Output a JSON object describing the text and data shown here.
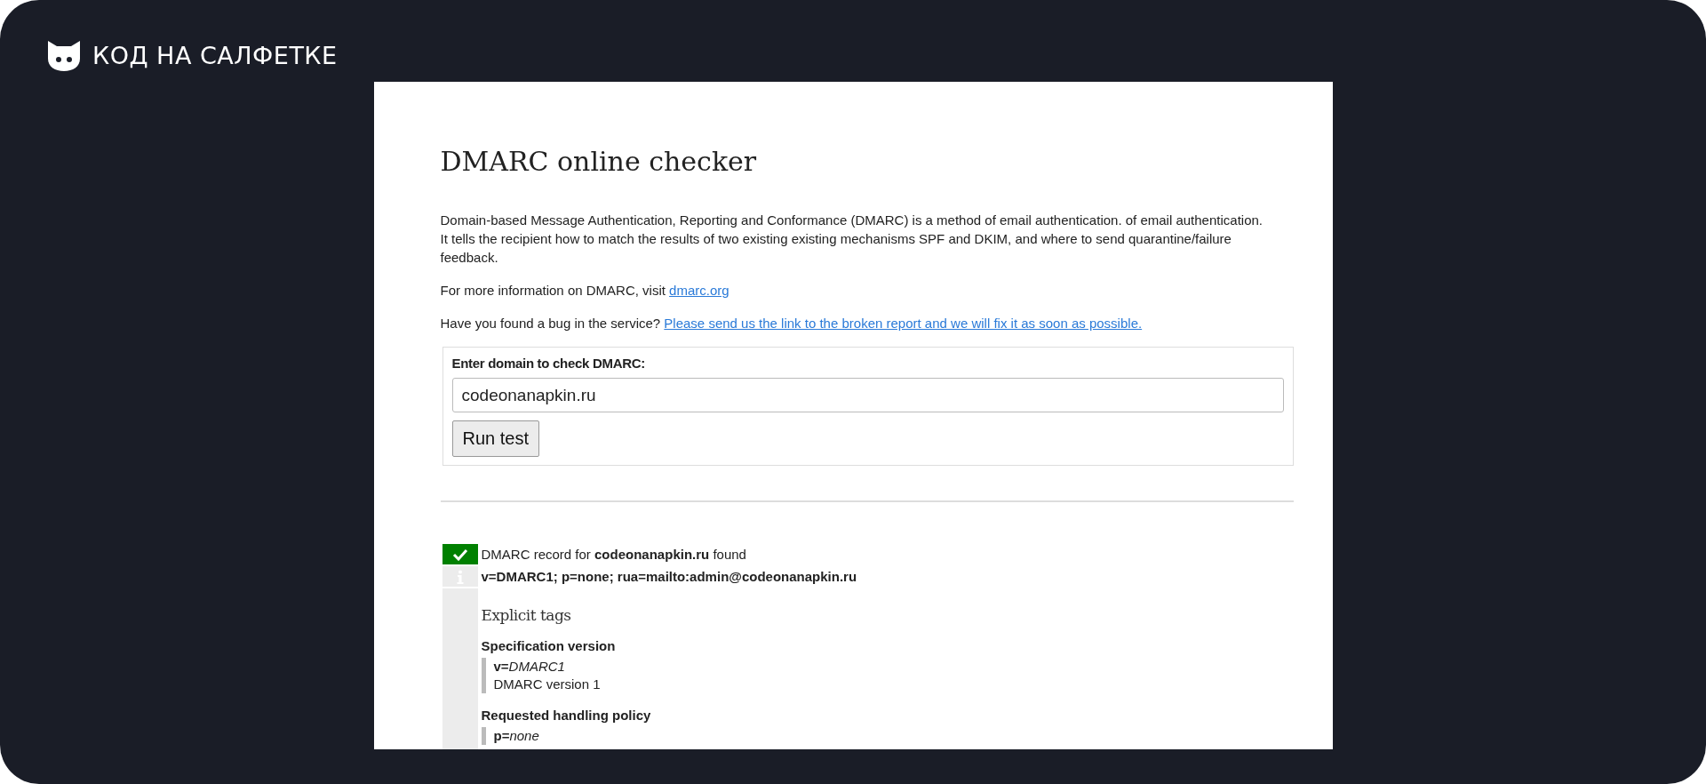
{
  "brand": {
    "name": "КОД НА САЛФЕТКЕ"
  },
  "page": {
    "title": "DMARC online checker",
    "intro": "Domain-based Message Authentication, Reporting and Conformance (DMARC) is a method of email authentication. of email authentication. It tells the recipient how to match the results of two existing existing mechanisms SPF and DKIM, and where to send quarantine/failure feedback.",
    "more_info": {
      "text": "For more information on DMARC, visit",
      "link": "dmarc.org"
    },
    "bug_report": {
      "text": "Have you found a bug in the service?",
      "link": "Please send us the link to the broken report and we will fix it as soon as possible."
    }
  },
  "form": {
    "label": "Enter domain to check DMARC:",
    "value": "codeonanapkin.ru",
    "button": "Run test"
  },
  "result": {
    "rows": [
      {
        "kind": "success",
        "text": "DMARC record for **codeonanapkin.ru** found"
      },
      {
        "kind": "info",
        "text": "v=DMARC1; p=none; rua=mailto:admin@codeonanapkin.ru"
      }
    ],
    "section_title": "Explicit tags",
    "tags": [
      {
        "title": "Specification version",
        "tag": "v=",
        "value": "DMARC1",
        "description": "DMARC version 1"
      },
      {
        "title": "Requested handling policy",
        "tag": "p=",
        "value": "none"
      }
    ]
  }
}
